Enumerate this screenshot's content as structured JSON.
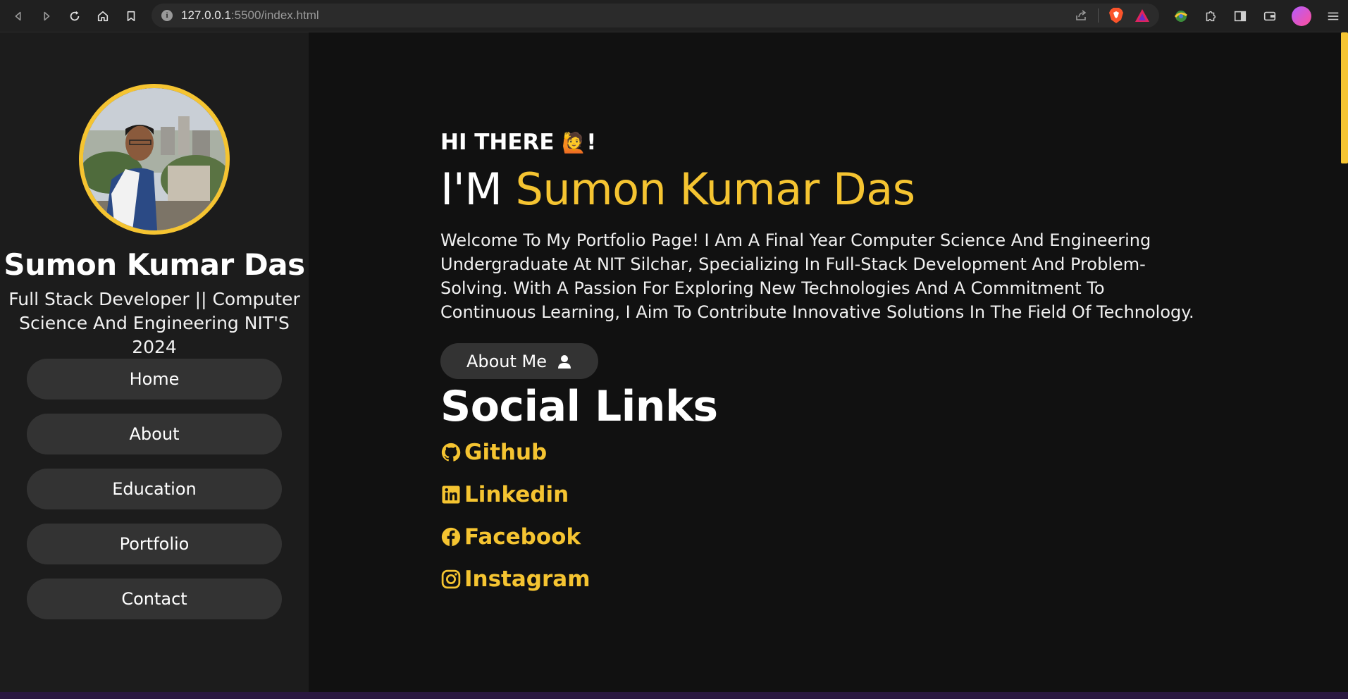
{
  "browser": {
    "url_host": "127.0.0.1",
    "url_path": ":5500/index.html",
    "icons": [
      "back-icon",
      "forward-icon",
      "reload-icon",
      "home-icon",
      "bookmark-icon",
      "share-icon",
      "brave-shield-icon",
      "brave-rewards-icon",
      "extension-icon",
      "puzzle-icon",
      "sidebar-icon",
      "wallet-icon",
      "profile-icon",
      "menu-icon"
    ]
  },
  "sidebar": {
    "name": "Sumon Kumar Das",
    "role": "Full Stack Developer || Computer Science And Engineering NIT'S 2024",
    "nav": [
      "Home",
      "About",
      "Education",
      "Portfolio",
      "Contact"
    ]
  },
  "main": {
    "greeting": "HI THERE",
    "greeting_emoji": "🙋",
    "greeting_end": "!",
    "headline_prefix": "I'M",
    "headline_name": "Sumon Kumar Das",
    "intro": "Welcome To My Portfolio Page! I Am A Final Year Computer Science And Engineering Undergraduate At NIT Silchar, Specializing In Full-Stack Development And Problem-Solving. With A Passion For Exploring New Technologies And A Commitment To Continuous Learning, I Aim To Contribute Innovative Solutions In The Field Of Technology.",
    "about_button": "About Me",
    "social_title": "Social Links",
    "social": [
      {
        "label": "Github",
        "icon": "github-icon"
      },
      {
        "label": "Linkedin",
        "icon": "linkedin-icon"
      },
      {
        "label": "Facebook",
        "icon": "facebook-icon"
      },
      {
        "label": "Instagram",
        "icon": "instagram-icon"
      }
    ]
  },
  "colors": {
    "accent": "#f5c431",
    "background": "#111111",
    "sidebar": "#1c1c1c",
    "button": "#333333"
  }
}
